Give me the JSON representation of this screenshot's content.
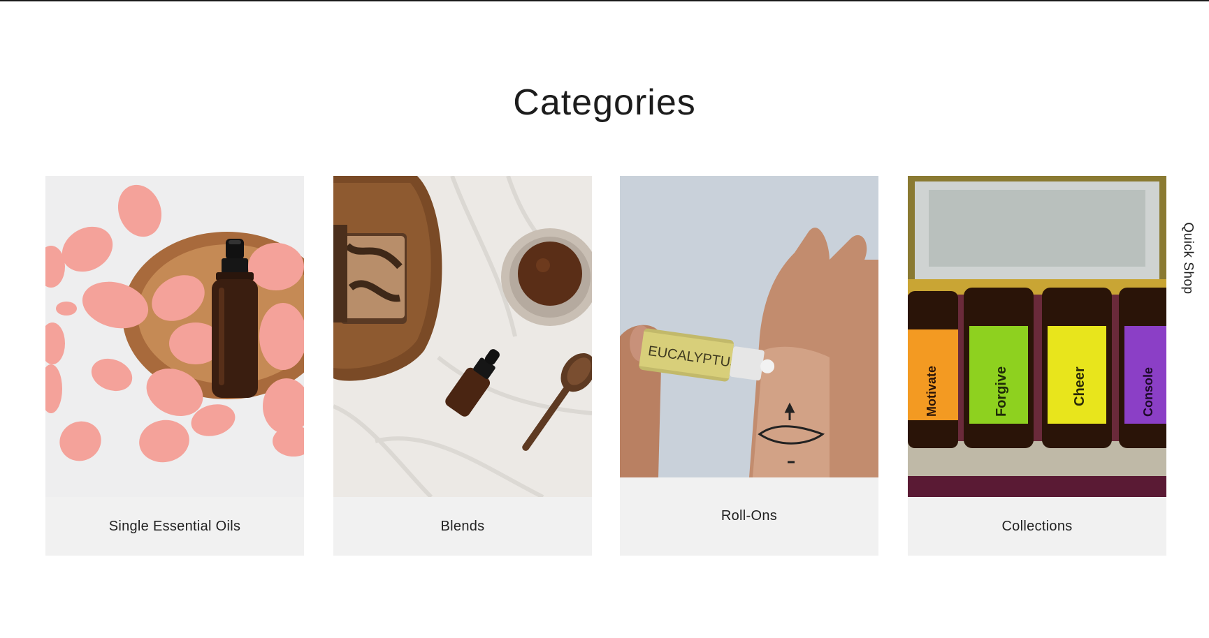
{
  "section": {
    "title": "Categories"
  },
  "categories": [
    {
      "label": "Single Essential Oils",
      "image": "rose-petals-dropper-bottle"
    },
    {
      "label": "Blends",
      "image": "soap-powder-dropper-spoon"
    },
    {
      "label": "Roll-Ons",
      "image": "eucalyptus-roller-on-wrist"
    },
    {
      "label": "Collections",
      "image": "essential-oil-bottle-set"
    }
  ],
  "bottle_labels": [
    "Motivate",
    "Forgive",
    "Cheer",
    "Console"
  ],
  "roller_label": "EUCALYPTUS",
  "quick_shop": {
    "label": "Quick Shop"
  },
  "colors": {
    "label_bg": "#f1f1f1",
    "text": "#222222",
    "petal": "#f4a29a",
    "amber": "#3a1e10",
    "motivate": "#f39a22",
    "forgive": "#8ed11f",
    "cheer": "#e8e51c",
    "console": "#8b3fc6"
  }
}
